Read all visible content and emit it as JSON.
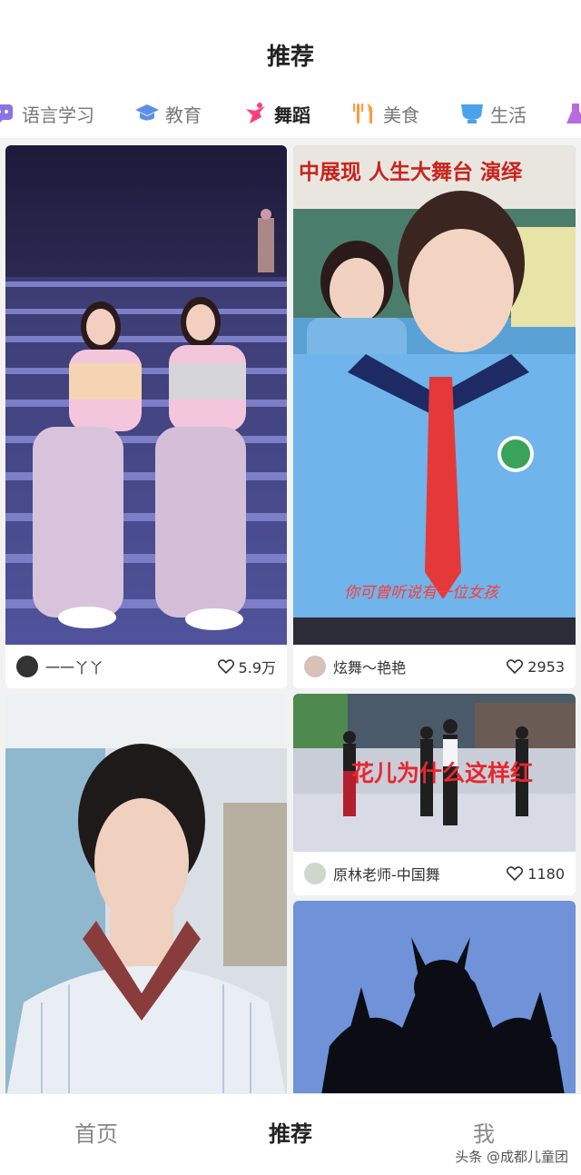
{
  "header": {
    "title": "推荐"
  },
  "categories": [
    {
      "label": "语言学习",
      "icon": "language-icon",
      "color": "#8a73e6",
      "active": false
    },
    {
      "label": "教育",
      "icon": "graduation-cap-icon",
      "color": "#5b8fe8",
      "active": false
    },
    {
      "label": "舞蹈",
      "icon": "dance-icon",
      "color": "#ff3f7a",
      "active": true
    },
    {
      "label": "美食",
      "icon": "fork-knife-icon",
      "color": "#ff9a3d",
      "active": false
    },
    {
      "label": "生活",
      "icon": "cup-icon",
      "color": "#4aa3e8",
      "active": false
    }
  ],
  "feed": {
    "cards": [
      {
        "author": "一一丫丫",
        "likes": "5.9万"
      },
      {
        "author": "炫舞～艳艳",
        "likes": "2953",
        "caption_top": "中展现 人生大舞台 演绎",
        "caption_bottom": "你可曾听说有一位女孩"
      },
      {
        "author": "",
        "likes": ""
      },
      {
        "author": "原林老师-中国舞",
        "likes": "1180",
        "caption": "花儿为什么这样红"
      },
      {
        "author": "",
        "likes": ""
      }
    ]
  },
  "tabbar": {
    "home": "首页",
    "recommend": "推荐",
    "me": "我"
  },
  "watermark": "头条 @成都儿童团",
  "colors": {
    "accent": "#ff3f7a",
    "text": "#222222",
    "muted": "#888888",
    "background": "#f2f2f2"
  }
}
